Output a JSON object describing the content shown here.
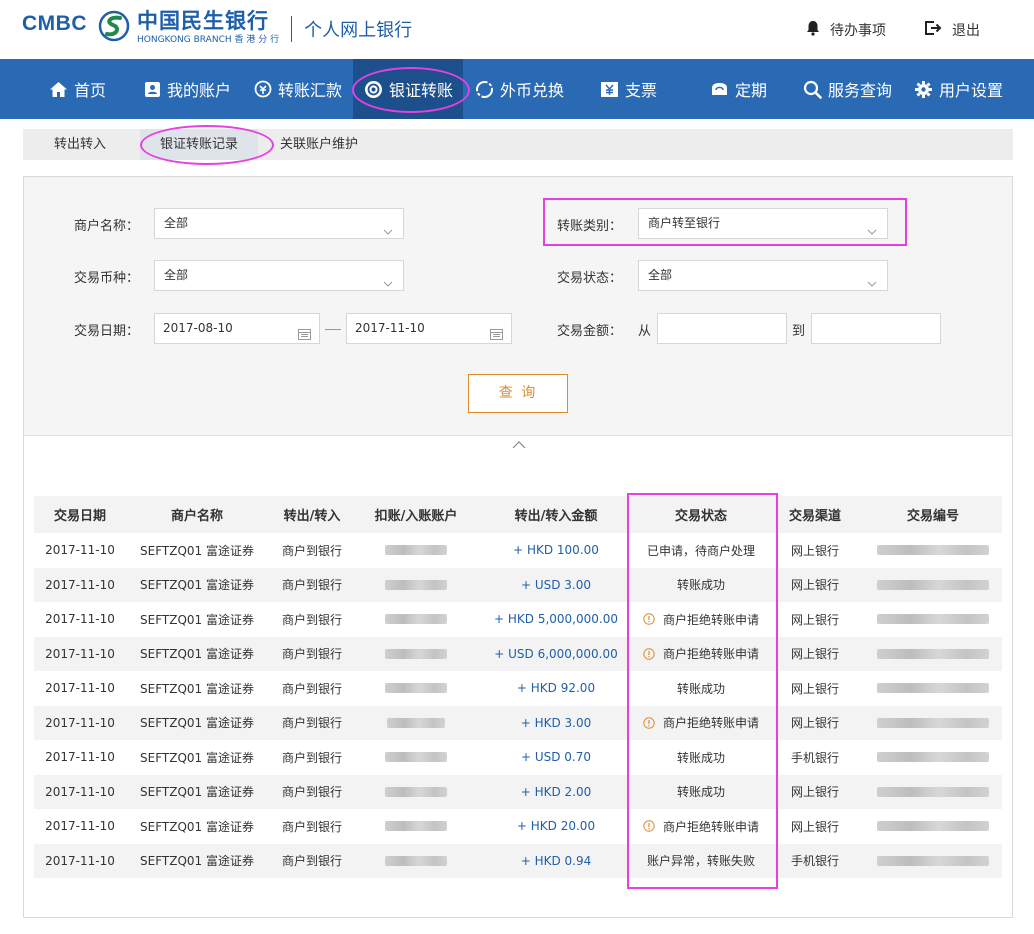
{
  "header": {
    "brand_en": "CMBC",
    "brand_cn": "中国民生银行",
    "brand_sub": "HONGKONG BRANCH 香 港 分 行",
    "site_title": "个人网上银行",
    "todo_label": "待办事项",
    "logout_label": "退出"
  },
  "nav": {
    "items": [
      {
        "label": "首页",
        "icon": "home-icon"
      },
      {
        "label": "我的账户",
        "icon": "account-icon"
      },
      {
        "label": "转账汇款",
        "icon": "transfer-icon"
      },
      {
        "label": "银证转账",
        "icon": "securities-icon",
        "active": true
      },
      {
        "label": "外币兑换",
        "icon": "exchange-icon"
      },
      {
        "label": "支票",
        "icon": "cheque-icon"
      },
      {
        "label": "定期",
        "icon": "deposit-icon"
      },
      {
        "label": "服务查询",
        "icon": "search-icon"
      },
      {
        "label": "用户设置",
        "icon": "gear-icon"
      }
    ]
  },
  "subtabs": [
    {
      "label": "转出转入"
    },
    {
      "label": "银证转账记录",
      "active": true
    },
    {
      "label": "关联账户维护"
    }
  ],
  "filter": {
    "merchant_label": "商户名称：",
    "merchant_value": "全部",
    "type_label": "转账类别：",
    "type_value": "商户转至银行",
    "currency_label": "交易币种：",
    "currency_value": "全部",
    "status_label": "交易状态：",
    "status_value": "全部",
    "date_label": "交易日期：",
    "date_from": "2017-08-10",
    "date_to": "2017-11-10",
    "amount_label": "交易金额：",
    "amount_from_label": "从",
    "amount_to_label": "到",
    "amount_from": "",
    "amount_to": "",
    "query_label": "查 询"
  },
  "table": {
    "headers": [
      "交易日期",
      "商户名称",
      "转出/转入",
      "扣账/入账账户",
      "转出/转入金额",
      "交易状态",
      "交易渠道",
      "交易编号"
    ],
    "rows": [
      {
        "date": "2017-11-10",
        "merchant": "SEFTZQ01 富途证券",
        "direction": "商户到银行",
        "amount": "+ HKD 100.00",
        "status": "已申请，待商户处理",
        "warn": false,
        "channel": "网上银行"
      },
      {
        "date": "2017-11-10",
        "merchant": "SEFTZQ01 富途证券",
        "direction": "商户到银行",
        "amount": "+ USD 3.00",
        "status": "转账成功",
        "warn": false,
        "channel": "网上银行"
      },
      {
        "date": "2017-11-10",
        "merchant": "SEFTZQ01 富途证券",
        "direction": "商户到银行",
        "amount": "+ HKD 5,000,000.00",
        "status": "商户拒绝转账申请",
        "warn": true,
        "channel": "网上银行"
      },
      {
        "date": "2017-11-10",
        "merchant": "SEFTZQ01 富途证券",
        "direction": "商户到银行",
        "amount": "+ USD 6,000,000.00",
        "status": "商户拒绝转账申请",
        "warn": true,
        "channel": "网上银行"
      },
      {
        "date": "2017-11-10",
        "merchant": "SEFTZQ01 富途证券",
        "direction": "商户到银行",
        "amount": "+ HKD 92.00",
        "status": "转账成功",
        "warn": false,
        "channel": "网上银行"
      },
      {
        "date": "2017-11-10",
        "merchant": "SEFTZQ01 富途证券",
        "direction": "商户到银行",
        "amount": "+ HKD 3.00",
        "status": "商户拒绝转账申请",
        "warn": true,
        "channel": "网上银行"
      },
      {
        "date": "2017-11-10",
        "merchant": "SEFTZQ01 富途证券",
        "direction": "商户到银行",
        "amount": "+ USD 0.70",
        "status": "转账成功",
        "warn": false,
        "channel": "手机银行"
      },
      {
        "date": "2017-11-10",
        "merchant": "SEFTZQ01 富途证券",
        "direction": "商户到银行",
        "amount": "+ HKD 2.00",
        "status": "转账成功",
        "warn": false,
        "channel": "网上银行"
      },
      {
        "date": "2017-11-10",
        "merchant": "SEFTZQ01 富途证券",
        "direction": "商户到银行",
        "amount": "+ HKD 20.00",
        "status": "商户拒绝转账申请",
        "warn": true,
        "channel": "网上银行"
      },
      {
        "date": "2017-11-10",
        "merchant": "SEFTZQ01 富途证券",
        "direction": "商户到银行",
        "amount": "+ HKD 0.94",
        "status": "账户异常，转账失败",
        "warn": false,
        "channel": "手机银行"
      }
    ]
  },
  "colors": {
    "brand_blue": "#2a6ab5",
    "nav_active": "#1d4f8d",
    "accent_orange": "#e08a2c",
    "highlight": "#e540e0"
  }
}
